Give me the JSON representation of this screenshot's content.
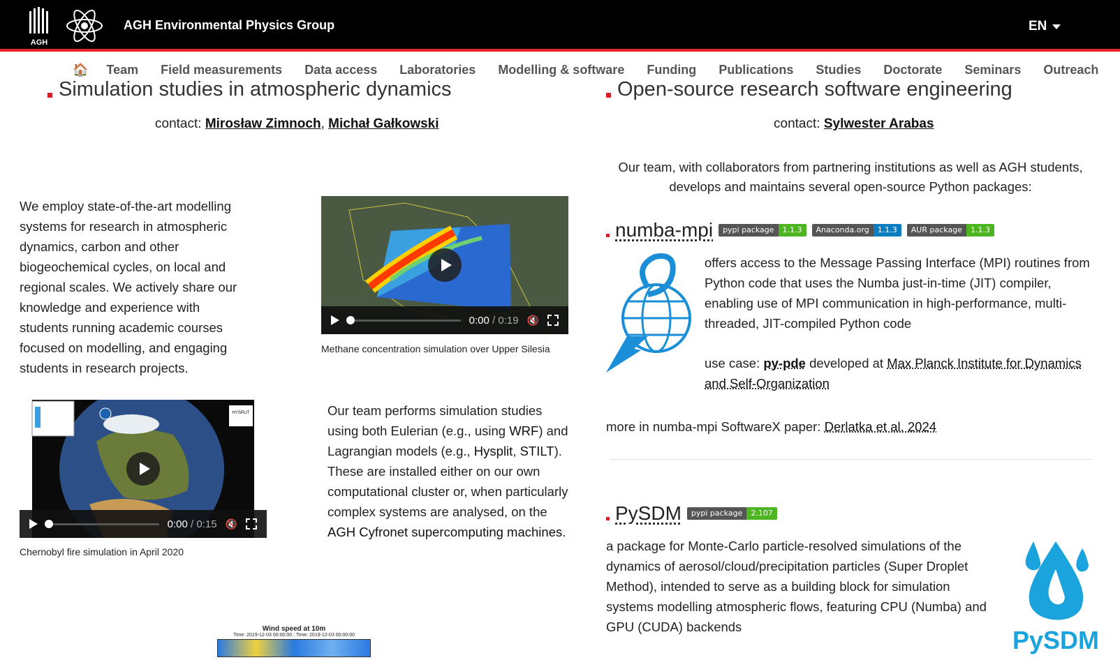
{
  "header": {
    "logo_text": "AGH",
    "site_title": "AGH Environmental Physics Group",
    "language": "EN"
  },
  "nav": {
    "home_icon": "🏠",
    "items": [
      "Team",
      "Field measurements",
      "Data access",
      "Laboratories",
      "Modelling & software",
      "Funding",
      "Publications",
      "Studies",
      "Doctorate",
      "Seminars",
      "Outreach"
    ]
  },
  "left": {
    "title": "Simulation studies in atmospheric dynamics",
    "contact_label": "contact:",
    "contacts": [
      "Mirosław Zimnoch",
      "Michał Gałkowski"
    ],
    "intro": "We employ state-of-the-art modelling systems for research in atmospheric dynamics, carbon and other biogeochemical cycles, on local and regional scales. We actively share our knowledge and experience with students running academic courses focused on modelling, and engaging students in research projects.",
    "video1": {
      "time": "0:00",
      "duration": "0:19",
      "caption": "Methane concentration simulation over Upper Silesia"
    },
    "video2": {
      "time": "0:00",
      "duration": "0:15",
      "caption": "Chernobyl fire simulation in April 2020",
      "overlay": "HYSPLIT"
    },
    "para2_a": "Our team performs simulation studies using both Eulerian (e.g., using ",
    "para2_wrf": "WRF",
    "para2_b": ") and Lagrangian models (e.g., ",
    "para2_hysplit": "Hysplit",
    "para2_c": ", ",
    "para2_stilt": "STILT",
    "para2_d": "). These are installed either on our own computational cluster or, when particularly complex systems are analysed, on the ",
    "para2_cyfronet": "AGH Cyfronet supercomputing machines",
    "para2_e": ".",
    "image3": {
      "title": "Wind speed at 10m",
      "subtitle": "Time: 2019-12-03 00:00:00 ; Time: 2019-12-03 00:00:00"
    }
  },
  "right": {
    "title": "Open-source research software engineering",
    "contact_label": "contact:",
    "contact": "Sylwester Arabas",
    "intro": "Our team, with collaborators from partnering institutions as well as AGH students, develops and maintains several open-source Python packages:",
    "numba": {
      "name": "numba-mpi",
      "badges": [
        {
          "label": "pypi package",
          "value": "1.1.3",
          "color": "#4cb51f"
        },
        {
          "label": "Anaconda.org",
          "value": "1.1.3",
          "color": "#0d7dc1"
        },
        {
          "label": "AUR package",
          "value": "1.1.3",
          "color": "#4cb51f"
        }
      ],
      "desc": "offers access to the Message Passing Interface (MPI) routines from Python code that uses the Numba just-in-time (JIT) compiler, enabling use of MPI communication in high-performance, multi-threaded, JIT-compiled Python code",
      "usecase_label": "use case:",
      "usecase_pkg": "py-pde",
      "usecase_mid": "developed at",
      "usecase_inst": "Max Planck Institute for Dynamics and Self-Organization",
      "more_label": "more in numba-mpi SoftwareX paper:",
      "more_link": "Derlatka et al. 2024"
    },
    "pysdm": {
      "name": "PySDM",
      "badge_label": "pypi package",
      "badge_value": "2.107",
      "desc": "a package for Monte-Carlo particle-resolved simulations of the dynamics of aerosol/cloud/precipitation particles (Super Droplet Method), intended to serve as a building block for simulation systems modelling atmospheric flows, featuring CPU (Numba) and GPU (CUDA) backends",
      "logo_text": "PySDM"
    }
  }
}
